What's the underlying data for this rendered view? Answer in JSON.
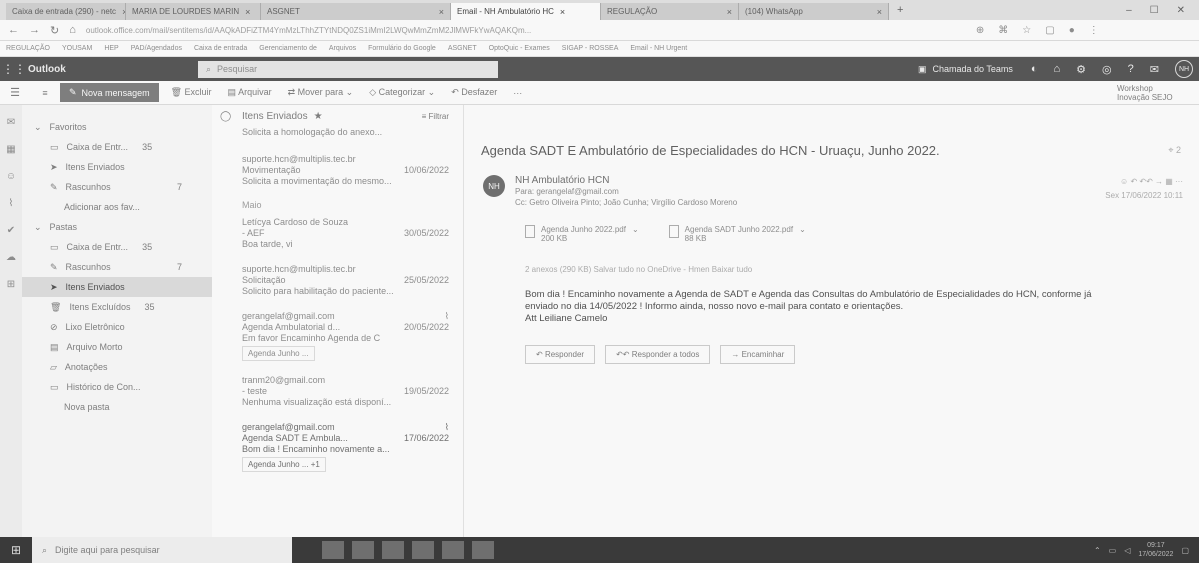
{
  "browser": {
    "tabs": [
      {
        "label": "Caixa de entrada (290) - netc"
      },
      {
        "label": "MARIA DE LOURDES MARIN"
      },
      {
        "label": "ASGNET"
      },
      {
        "label": "Email - NH Ambulatório HC"
      },
      {
        "label": "REGULAÇÃO"
      },
      {
        "label": "(104) WhatsApp"
      }
    ],
    "url": "outlook.office.com/mail/sentitems/id/AAQkADFiZTM4YmMzLThhZTYtNDQ0ZS1iMmI2LWQwMmZmM2JlMWFkYwAQAKQm...",
    "bookmarks": [
      "REGULAÇÃO",
      "YOUSAM",
      "HEP",
      "PAD/Agendados",
      "Caixa de entrada",
      "Gerenciamento de",
      "Arquivos",
      "Formulário do Google",
      "ASGNET",
      "OptoQuic - Exames",
      "SIGAP - ROSSEA",
      "Email - NH Urgent"
    ]
  },
  "outlook": {
    "brand": "Outlook",
    "search_placeholder": "Pesquisar",
    "teams_call": "Chamada do Teams",
    "avatar": "NH",
    "new_message": "Nova mensagem",
    "toolbar": [
      "Excluir",
      "Arquivar",
      "Mover para",
      "Categorizar",
      "Desfazer",
      "···"
    ],
    "workshop": "Workshop Inovação SEJO"
  },
  "folders": {
    "favorites_header": "Favoritos",
    "favorites": [
      {
        "label": "Caixa de Entr...",
        "count": "35"
      },
      {
        "label": "Itens Enviados",
        "count": ""
      },
      {
        "label": "Rascunhos",
        "count": "7"
      },
      {
        "label": "Adicionar aos fav...",
        "count": ""
      }
    ],
    "pastas_header": "Pastas",
    "pastas": [
      {
        "label": "Caixa de Entr...",
        "count": "35"
      },
      {
        "label": "Rascunhos",
        "count": "7"
      },
      {
        "label": "Itens Enviados",
        "count": ""
      },
      {
        "label": "Itens Excluídos",
        "count": "35"
      },
      {
        "label": "Lixo Eletrônico",
        "count": ""
      },
      {
        "label": "Arquivo Morto",
        "count": ""
      },
      {
        "label": "Anotações",
        "count": ""
      },
      {
        "label": "Histórico de Con...",
        "count": ""
      },
      {
        "label": "Nova pasta",
        "count": ""
      }
    ]
  },
  "list": {
    "title": "Itens Enviados",
    "filter": "Filtrar",
    "top_preview": "Solicita a homologação do anexo...",
    "items": [
      {
        "from": "suporte.hcn@multiplis.tec.br",
        "subject": "Movimentação",
        "date": "10/06/2022",
        "preview": "Solicita a movimentação do mesmo...",
        "att": ""
      },
      {
        "from": "Letícya Cardoso de Souza",
        "subject": "- AEF",
        "date": "30/05/2022",
        "preview": "Boa tarde, vi",
        "att": ""
      },
      {
        "from": "suporte.hcn@multiplis.tec.br",
        "subject": "Solicitação",
        "date": "25/05/2022",
        "preview": "Solicito para habilitação do paciente...",
        "att": ""
      },
      {
        "from": "gerangelaf@gmail.com",
        "subject": "Agenda Ambulatorial d...",
        "date": "20/05/2022",
        "preview": "Em favor Encaminho Agenda de C",
        "att": "Agenda Junho ..."
      },
      {
        "from": "tranm20@gmail.com",
        "subject": "- teste",
        "date": "19/05/2022",
        "preview": "Nenhuma visualização está disponí...",
        "att": ""
      },
      {
        "from": "gerangelaf@gmail.com",
        "subject": "Agenda SADT E Ambula...",
        "date": "17/06/2022",
        "preview": "Bom dia ! Encaminho novamente a...",
        "att": "Agenda Junho ... +1"
      }
    ],
    "group_label": "Maio"
  },
  "reading": {
    "subject": "Agenda SADT E Ambulatório de Especialidades do HCN - Uruaçu, Junho 2022.",
    "count": "2",
    "initials": "NH",
    "sender": "NH Ambulatório HCN",
    "to": "Para: gerangelaf@gmail.com",
    "cc": "Cc: Getro Oliveira Pinto; João Cunha; Virgílio Cardoso Moreno",
    "date": "Sex 17/06/2022 10:11",
    "attachments": [
      {
        "name": "Agenda Junho 2022.pdf",
        "size": "200 KB"
      },
      {
        "name": "Agenda SADT Junho 2022.pdf",
        "size": "88 KB"
      }
    ],
    "download": "2 anexos (290 KB)   Salvar tudo no OneDrive - Hmen   Baixar tudo",
    "body_lines": [
      "Bom dia ! Encaminho novamente a Agenda de SADT e Agenda das Consultas do Ambulatório de Especialidades do HCN, conforme já",
      "enviado no dia 14/05/2022 ! Informo ainda, nosso novo e-mail para contato e orientações.",
      "Att Leiliane Camelo"
    ],
    "actions": [
      "Responder",
      "Responder a todos",
      "Encaminhar"
    ]
  },
  "taskbar": {
    "search": "Digite aqui para pesquisar",
    "time": "09:17",
    "date": "17/06/2022"
  }
}
